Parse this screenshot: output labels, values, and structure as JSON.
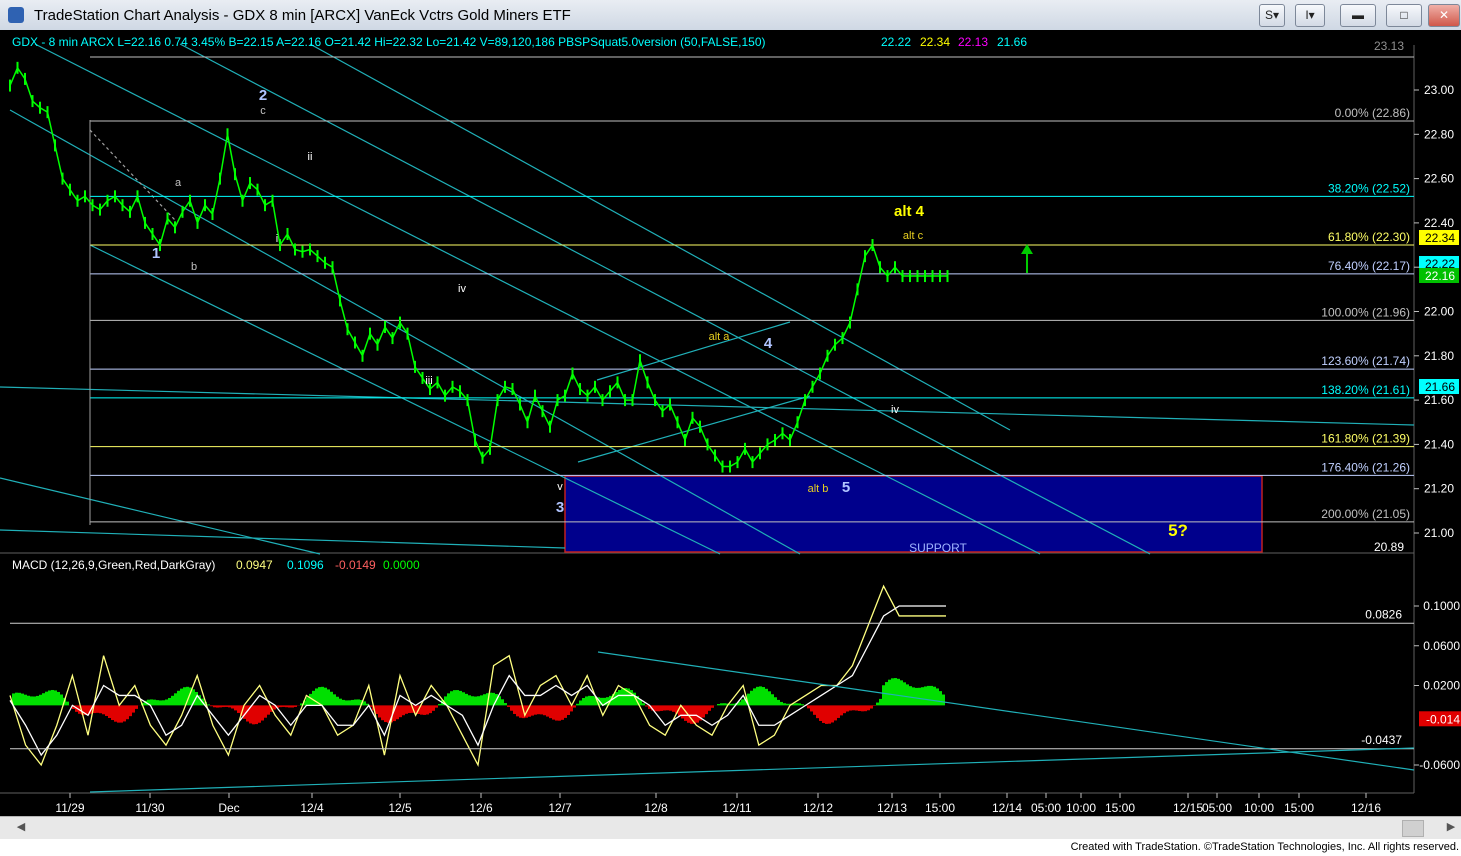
{
  "window": {
    "title": "TradeStation Chart Analysis - GDX 8 min [ARCX] VanEck Vctrs Gold Miners ETF",
    "btn_s": "S",
    "btn_i": "I",
    "icons": [
      "app-icon",
      "minimize-icon",
      "maximize-icon",
      "close-icon"
    ]
  },
  "header": {
    "symbol": "GDX - 8 min  ARCX  L=22.16  0.74  3.45%  B=22.15  A=22.16  O=21.42  Hi=22.32  Lo=21.42  V=89,120,186  PBSPSquat5.0version (50,FALSE,150)",
    "values": [
      {
        "text": "22.22",
        "color": "#00ffff"
      },
      {
        "text": "22.34",
        "color": "#ffff00"
      },
      {
        "text": "22.13",
        "color": "#ff00ff"
      },
      {
        "text": "21.66",
        "color": "#00ffff"
      }
    ]
  },
  "chart_data": [
    {
      "type": "line",
      "panel": "price",
      "yaxis": {
        "min": 20.89,
        "max": 23.1,
        "ticks": [
          "23.00",
          "22.80",
          "22.60",
          "22.40",
          "22.20",
          "22.00",
          "21.80",
          "21.60",
          "21.40",
          "21.20",
          "21.00"
        ],
        "tick_values": [
          23.0,
          22.8,
          22.6,
          22.4,
          22.2,
          22.0,
          21.8,
          21.6,
          21.4,
          21.2,
          21.0
        ],
        "bottom_label": "20.89",
        "top_label": "23.13"
      },
      "xaxis": {
        "labels": [
          "11/29",
          "11/30",
          "Dec",
          "12/4",
          "12/5",
          "12/6",
          "12/7",
          "12/8",
          "12/11",
          "12/12",
          "12/13",
          "15:00",
          "12/14",
          "05:00",
          "10:00",
          "15:00",
          "12/15",
          "05:00",
          "10:00",
          "15:00",
          "12/16"
        ]
      },
      "series": [
        {
          "color": "#00ff00",
          "x": [
            0,
            2,
            4,
            6,
            8,
            10,
            12,
            14,
            16,
            18,
            20,
            22,
            24,
            26,
            28,
            30,
            32,
            34,
            36,
            38,
            40,
            42,
            44,
            46,
            48,
            50,
            52,
            54,
            56,
            58,
            60,
            62,
            64,
            66,
            68,
            70,
            72,
            74,
            76,
            78,
            80,
            82,
            84,
            86,
            88,
            90,
            92,
            94,
            96,
            98,
            100,
            102,
            104,
            106,
            108,
            110,
            112,
            114,
            116,
            118,
            120,
            122,
            124,
            126,
            128,
            130,
            132,
            134,
            136,
            138,
            140,
            142,
            144,
            146,
            148,
            150,
            152,
            154,
            156,
            158,
            160,
            162,
            164,
            166,
            168,
            170,
            172,
            174,
            176,
            178,
            180,
            182,
            184,
            186,
            188,
            190,
            192,
            194,
            196,
            198,
            200,
            202,
            204,
            206,
            208,
            210,
            212,
            214,
            216,
            218,
            220,
            222,
            224,
            226,
            228,
            230,
            232,
            234,
            236,
            238,
            240,
            242,
            244,
            246,
            248,
            250
          ],
          "y": [
            23.02,
            23.1,
            23.05,
            22.95,
            22.92,
            22.9,
            22.75,
            22.6,
            22.55,
            22.5,
            22.52,
            22.48,
            22.46,
            22.5,
            22.52,
            22.48,
            22.45,
            22.52,
            22.4,
            22.35,
            22.3,
            22.42,
            22.38,
            22.45,
            22.5,
            22.4,
            22.48,
            22.44,
            22.6,
            22.8,
            22.62,
            22.5,
            22.58,
            22.55,
            22.48,
            22.5,
            22.3,
            22.35,
            22.28,
            22.27,
            22.28,
            22.25,
            22.22,
            22.2,
            22.05,
            21.92,
            21.86,
            21.8,
            21.9,
            21.85,
            21.93,
            21.88,
            21.95,
            21.9,
            21.75,
            21.7,
            21.65,
            21.68,
            21.62,
            21.66,
            21.64,
            21.6,
            21.42,
            21.34,
            21.38,
            21.6,
            21.66,
            21.65,
            21.58,
            21.5,
            21.62,
            21.55,
            21.48,
            21.6,
            21.62,
            21.72,
            21.65,
            21.62,
            21.66,
            21.6,
            21.64,
            21.68,
            21.6,
            21.6,
            21.78,
            21.68,
            21.6,
            21.55,
            21.58,
            21.5,
            21.42,
            21.52,
            21.48,
            21.4,
            21.35,
            21.3,
            21.3,
            21.32,
            21.38,
            21.32,
            21.36,
            21.4,
            21.42,
            21.45,
            21.42,
            21.5,
            21.6,
            21.66,
            21.72,
            21.8,
            21.85,
            21.88,
            21.95,
            22.1,
            22.25,
            22.3,
            22.2,
            22.16,
            22.2,
            22.16,
            22.16,
            22.16,
            22.16,
            22.16,
            22.16,
            22.16
          ]
        }
      ]
    },
    {
      "type": "line",
      "panel": "macd",
      "legend": "MACD (12,26,9,Green,Red,DarkGray)",
      "values_text": [
        {
          "text": "0.0947",
          "color": "#ffff80"
        },
        {
          "text": "0.1096",
          "color": "#00ffff"
        },
        {
          "text": "-0.0149",
          "color": "#ff6060"
        },
        {
          "text": "0.0000",
          "color": "#00ff00"
        }
      ],
      "yaxis": {
        "min": -0.075,
        "max": 0.12,
        "ticks": [
          "0.1000",
          "0.0600",
          "0.0200",
          "-0.0600"
        ],
        "tick_values": [
          0.1,
          0.06,
          0.02,
          -0.06
        ]
      },
      "levels": [
        {
          "label": "0.0826",
          "value": 0.0826
        },
        {
          "label": "-0.0437",
          "value": -0.0437
        }
      ],
      "highlight": {
        "label": "-0.014",
        "value": -0.014
      },
      "series": [
        {
          "name": "MACD",
          "color": "#ffff80",
          "x": [
            0,
            4,
            8,
            12,
            16,
            20,
            24,
            28,
            32,
            36,
            40,
            44,
            48,
            52,
            56,
            60,
            64,
            68,
            72,
            76,
            80,
            84,
            88,
            92,
            96,
            100,
            104,
            108,
            112,
            116,
            120,
            124,
            128,
            132,
            136,
            140,
            144,
            148,
            152,
            156,
            160,
            164,
            168,
            172,
            176,
            180,
            184,
            188,
            192,
            196,
            200,
            204,
            208,
            212,
            216,
            220,
            224,
            228,
            232,
            236,
            240
          ],
          "y": [
            0.01,
            -0.04,
            -0.06,
            -0.02,
            0.03,
            -0.03,
            0.05,
            0.0,
            0.02,
            -0.02,
            -0.04,
            -0.01,
            0.03,
            -0.02,
            -0.05,
            0.0,
            0.02,
            -0.01,
            -0.03,
            0.01,
            0.0,
            -0.03,
            -0.02,
            0.02,
            -0.05,
            0.03,
            -0.01,
            0.02,
            0.0,
            -0.03,
            -0.06,
            0.04,
            0.05,
            -0.01,
            0.02,
            0.03,
            0.0,
            0.03,
            -0.01,
            0.02,
            0.01,
            -0.02,
            -0.03,
            0.0,
            -0.02,
            -0.03,
            0.0,
            0.02,
            -0.04,
            -0.03,
            0.0,
            0.01,
            0.02,
            0.02,
            0.04,
            0.08,
            0.12,
            0.09,
            0.09,
            0.09,
            0.09
          ]
        },
        {
          "name": "Signal",
          "color": "#ffffff",
          "x": [
            0,
            4,
            8,
            12,
            16,
            20,
            24,
            28,
            32,
            36,
            40,
            44,
            48,
            52,
            56,
            60,
            64,
            68,
            72,
            76,
            80,
            84,
            88,
            92,
            96,
            100,
            104,
            108,
            112,
            116,
            120,
            124,
            128,
            132,
            136,
            140,
            144,
            148,
            152,
            156,
            160,
            164,
            168,
            172,
            176,
            180,
            184,
            188,
            192,
            196,
            200,
            204,
            208,
            212,
            216,
            220,
            224,
            228,
            232,
            236,
            240
          ],
          "y": [
            0.005,
            -0.02,
            -0.05,
            -0.03,
            0.0,
            -0.01,
            0.02,
            0.01,
            0.01,
            0.0,
            -0.03,
            -0.02,
            0.01,
            -0.01,
            -0.03,
            -0.01,
            0.01,
            0.0,
            -0.02,
            0.0,
            0.0,
            -0.02,
            -0.02,
            0.0,
            -0.03,
            0.01,
            0.0,
            0.01,
            0.0,
            -0.01,
            -0.04,
            0.0,
            0.03,
            0.01,
            0.01,
            0.02,
            0.01,
            0.02,
            0.0,
            0.01,
            0.01,
            0.0,
            -0.02,
            -0.01,
            -0.01,
            -0.02,
            -0.01,
            0.01,
            -0.02,
            -0.02,
            -0.01,
            0.0,
            0.01,
            0.02,
            0.03,
            0.06,
            0.09,
            0.1,
            0.1,
            0.1,
            0.1
          ]
        }
      ]
    }
  ],
  "fib_levels": [
    {
      "label": "0.00% (22.86)",
      "value": 22.86,
      "color": "#c0c0c0"
    },
    {
      "label": "38.20% (22.52)",
      "value": 22.52,
      "color": "#00ffff"
    },
    {
      "label": "61.80% (22.30)",
      "value": 22.3,
      "color": "#ffff66"
    },
    {
      "label": "76.40% (22.17)",
      "value": 22.17,
      "color": "#c0d0ff"
    },
    {
      "label": "100.00% (21.96)",
      "value": 21.96,
      "color": "#c0c0c0"
    },
    {
      "label": "123.60% (21.74)",
      "value": 21.74,
      "color": "#c0d0ff"
    },
    {
      "label": "138.20% (21.61)",
      "value": 21.61,
      "color": "#00ffff"
    },
    {
      "label": "161.80% (21.39)",
      "value": 21.39,
      "color": "#ffff66"
    },
    {
      "label": "176.40% (21.26)",
      "value": 21.26,
      "color": "#c0d0ff"
    },
    {
      "label": "200.00% (21.05)",
      "value": 21.05,
      "color": "#c0c0c0"
    }
  ],
  "price_tags": [
    {
      "text": "22.34",
      "value": 22.34,
      "bg": "#ffff00",
      "fg": "#000000"
    },
    {
      "text": "22.22",
      "value": 22.22,
      "bg": "#00ffff",
      "fg": "#000000"
    },
    {
      "text": "22.16",
      "value": 22.16,
      "bg": "#00c000",
      "fg": "#ffffff"
    },
    {
      "text": "21.66",
      "value": 21.66,
      "bg": "#00ffff",
      "fg": "#000000"
    }
  ],
  "annotations": [
    {
      "text": "2",
      "color": "#b0c4ff",
      "size": 15
    },
    {
      "text": "c",
      "color": "#c0c0c0",
      "size": 11
    },
    {
      "text": "ii",
      "color": "#ffffff",
      "size": 11
    },
    {
      "text": "a",
      "color": "#c0c0c0",
      "size": 11
    },
    {
      "text": "i",
      "color": "#ffffff",
      "size": 11
    },
    {
      "text": "1",
      "color": "#b0c4ff",
      "size": 15
    },
    {
      "text": "b",
      "color": "#c0c0c0",
      "size": 11
    },
    {
      "text": "iv",
      "color": "#ffffff",
      "size": 11
    },
    {
      "text": "iii",
      "color": "#ffffff",
      "size": 11
    },
    {
      "text": "v",
      "color": "#ffffff",
      "size": 11
    },
    {
      "text": "3",
      "color": "#b0c4ff",
      "size": 15
    },
    {
      "text": "alt a",
      "color": "#e8d020",
      "size": 11
    },
    {
      "text": "4",
      "color": "#b0c4ff",
      "size": 15
    },
    {
      "text": "alt b",
      "color": "#e8d020",
      "size": 11
    },
    {
      "text": "5",
      "color": "#b0c4ff",
      "size": 15
    },
    {
      "text": "iv",
      "color": "#ffffff",
      "size": 11
    },
    {
      "text": "alt 4",
      "color": "#ffff00",
      "size": 15
    },
    {
      "text": "alt c",
      "color": "#e8d020",
      "size": 11
    },
    {
      "text": "5?",
      "color": "#ffff00",
      "size": 17
    },
    {
      "text": "SUPPORT",
      "color": "#a0b4ff",
      "size": 12
    }
  ],
  "footer": {
    "copyright": "Created with TradeStation. ©TradeStation Technologies, Inc. All rights reserved."
  }
}
